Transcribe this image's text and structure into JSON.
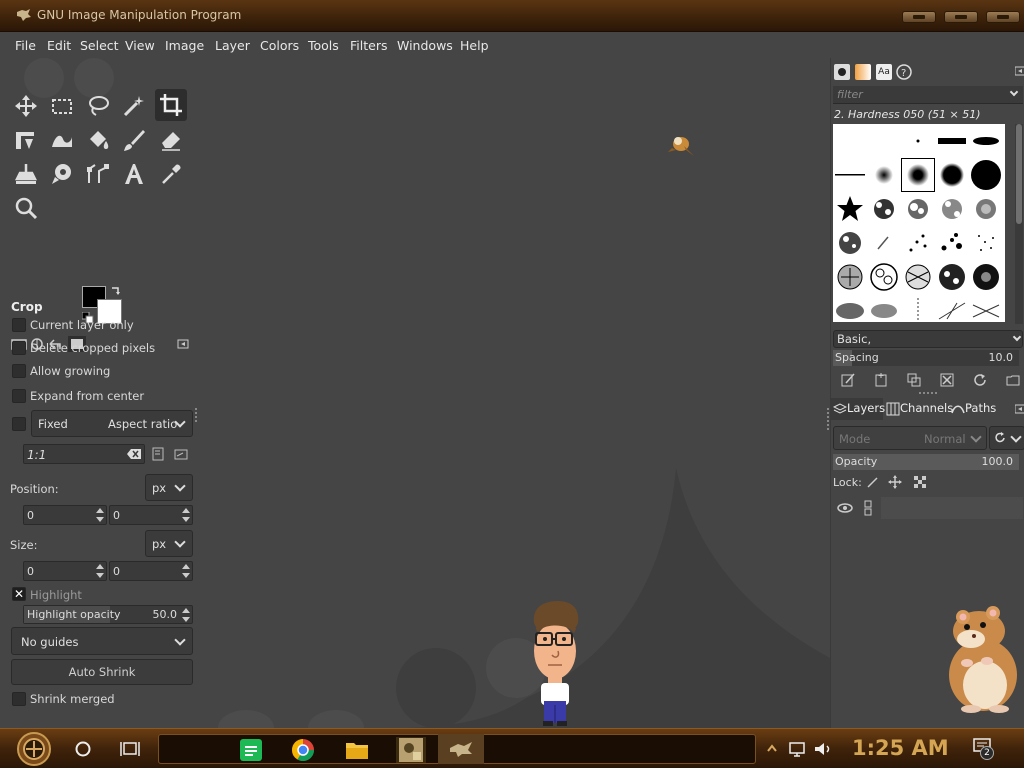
{
  "window": {
    "title": "GNU Image Manipulation Program"
  },
  "menu": [
    "File",
    "Edit",
    "Select",
    "View",
    "Image",
    "Layer",
    "Colors",
    "Tools",
    "Filters",
    "Windows",
    "Help"
  ],
  "tool_options": {
    "title": "Crop",
    "current_layer_only": "Current layer only",
    "delete_cropped_pixels": "Delete cropped pixels",
    "allow_growing": "Allow growing",
    "expand_from_center": "Expand from center",
    "fixed_label": "Fixed",
    "fixed_mode": "Aspect ratio",
    "ratio_value": "1:1",
    "position_label": "Position:",
    "position_unit": "px",
    "position_x": "0",
    "position_y": "0",
    "size_label": "Size:",
    "size_unit": "px",
    "size_w": "0",
    "size_h": "0",
    "highlight_label": "Highlight",
    "highlight_opacity_label": "Highlight opacity",
    "highlight_opacity_value": "50.0",
    "guides": "No guides",
    "auto_shrink": "Auto Shrink",
    "shrink_merged": "Shrink merged"
  },
  "brushes": {
    "tab_text": "Aa",
    "filter_placeholder": "filter",
    "selected": "2. Hardness 050 (51 × 51)",
    "preset": "Basic,",
    "spacing_label": "Spacing",
    "spacing_value": "10.0",
    "spacing_fraction": 0.1
  },
  "layers": {
    "tabs": [
      "Layers",
      "Channels",
      "Paths"
    ],
    "mode_label": "Mode",
    "mode_value": "Normal",
    "opacity_label": "Opacity",
    "opacity_value": "100.0",
    "lock_label": "Lock:"
  },
  "taskbar": {
    "clock": "1:25 AM",
    "notification_count": "2",
    "pinned": [
      "spotify-app",
      "chrome-app",
      "file-explorer-app",
      "gimp-app-1",
      "gimp-app-2"
    ]
  },
  "colors": {
    "foreground": "#000000",
    "background": "#ffffff",
    "chrome": "#454545"
  }
}
